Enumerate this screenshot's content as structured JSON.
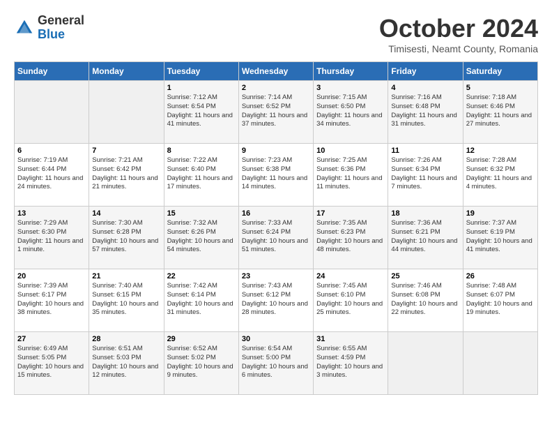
{
  "logo": {
    "general": "General",
    "blue": "Blue"
  },
  "title": "October 2024",
  "subtitle": "Timisesti, Neamt County, Romania",
  "weekdays": [
    "Sunday",
    "Monday",
    "Tuesday",
    "Wednesday",
    "Thursday",
    "Friday",
    "Saturday"
  ],
  "weeks": [
    [
      {
        "day": "",
        "info": ""
      },
      {
        "day": "",
        "info": ""
      },
      {
        "day": "1",
        "info": "Sunrise: 7:12 AM\nSunset: 6:54 PM\nDaylight: 11 hours and 41 minutes."
      },
      {
        "day": "2",
        "info": "Sunrise: 7:14 AM\nSunset: 6:52 PM\nDaylight: 11 hours and 37 minutes."
      },
      {
        "day": "3",
        "info": "Sunrise: 7:15 AM\nSunset: 6:50 PM\nDaylight: 11 hours and 34 minutes."
      },
      {
        "day": "4",
        "info": "Sunrise: 7:16 AM\nSunset: 6:48 PM\nDaylight: 11 hours and 31 minutes."
      },
      {
        "day": "5",
        "info": "Sunrise: 7:18 AM\nSunset: 6:46 PM\nDaylight: 11 hours and 27 minutes."
      }
    ],
    [
      {
        "day": "6",
        "info": "Sunrise: 7:19 AM\nSunset: 6:44 PM\nDaylight: 11 hours and 24 minutes."
      },
      {
        "day": "7",
        "info": "Sunrise: 7:21 AM\nSunset: 6:42 PM\nDaylight: 11 hours and 21 minutes."
      },
      {
        "day": "8",
        "info": "Sunrise: 7:22 AM\nSunset: 6:40 PM\nDaylight: 11 hours and 17 minutes."
      },
      {
        "day": "9",
        "info": "Sunrise: 7:23 AM\nSunset: 6:38 PM\nDaylight: 11 hours and 14 minutes."
      },
      {
        "day": "10",
        "info": "Sunrise: 7:25 AM\nSunset: 6:36 PM\nDaylight: 11 hours and 11 minutes."
      },
      {
        "day": "11",
        "info": "Sunrise: 7:26 AM\nSunset: 6:34 PM\nDaylight: 11 hours and 7 minutes."
      },
      {
        "day": "12",
        "info": "Sunrise: 7:28 AM\nSunset: 6:32 PM\nDaylight: 11 hours and 4 minutes."
      }
    ],
    [
      {
        "day": "13",
        "info": "Sunrise: 7:29 AM\nSunset: 6:30 PM\nDaylight: 11 hours and 1 minute."
      },
      {
        "day": "14",
        "info": "Sunrise: 7:30 AM\nSunset: 6:28 PM\nDaylight: 10 hours and 57 minutes."
      },
      {
        "day": "15",
        "info": "Sunrise: 7:32 AM\nSunset: 6:26 PM\nDaylight: 10 hours and 54 minutes."
      },
      {
        "day": "16",
        "info": "Sunrise: 7:33 AM\nSunset: 6:24 PM\nDaylight: 10 hours and 51 minutes."
      },
      {
        "day": "17",
        "info": "Sunrise: 7:35 AM\nSunset: 6:23 PM\nDaylight: 10 hours and 48 minutes."
      },
      {
        "day": "18",
        "info": "Sunrise: 7:36 AM\nSunset: 6:21 PM\nDaylight: 10 hours and 44 minutes."
      },
      {
        "day": "19",
        "info": "Sunrise: 7:37 AM\nSunset: 6:19 PM\nDaylight: 10 hours and 41 minutes."
      }
    ],
    [
      {
        "day": "20",
        "info": "Sunrise: 7:39 AM\nSunset: 6:17 PM\nDaylight: 10 hours and 38 minutes."
      },
      {
        "day": "21",
        "info": "Sunrise: 7:40 AM\nSunset: 6:15 PM\nDaylight: 10 hours and 35 minutes."
      },
      {
        "day": "22",
        "info": "Sunrise: 7:42 AM\nSunset: 6:14 PM\nDaylight: 10 hours and 31 minutes."
      },
      {
        "day": "23",
        "info": "Sunrise: 7:43 AM\nSunset: 6:12 PM\nDaylight: 10 hours and 28 minutes."
      },
      {
        "day": "24",
        "info": "Sunrise: 7:45 AM\nSunset: 6:10 PM\nDaylight: 10 hours and 25 minutes."
      },
      {
        "day": "25",
        "info": "Sunrise: 7:46 AM\nSunset: 6:08 PM\nDaylight: 10 hours and 22 minutes."
      },
      {
        "day": "26",
        "info": "Sunrise: 7:48 AM\nSunset: 6:07 PM\nDaylight: 10 hours and 19 minutes."
      }
    ],
    [
      {
        "day": "27",
        "info": "Sunrise: 6:49 AM\nSunset: 5:05 PM\nDaylight: 10 hours and 15 minutes."
      },
      {
        "day": "28",
        "info": "Sunrise: 6:51 AM\nSunset: 5:03 PM\nDaylight: 10 hours and 12 minutes."
      },
      {
        "day": "29",
        "info": "Sunrise: 6:52 AM\nSunset: 5:02 PM\nDaylight: 10 hours and 9 minutes."
      },
      {
        "day": "30",
        "info": "Sunrise: 6:54 AM\nSunset: 5:00 PM\nDaylight: 10 hours and 6 minutes."
      },
      {
        "day": "31",
        "info": "Sunrise: 6:55 AM\nSunset: 4:59 PM\nDaylight: 10 hours and 3 minutes."
      },
      {
        "day": "",
        "info": ""
      },
      {
        "day": "",
        "info": ""
      }
    ]
  ]
}
